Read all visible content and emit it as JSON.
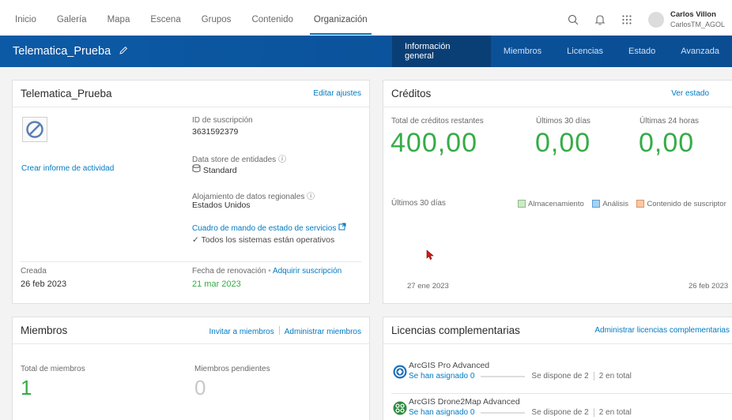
{
  "nav": {
    "links": [
      "Inicio",
      "Galería",
      "Mapa",
      "Escena",
      "Grupos",
      "Contenido",
      "Organización"
    ],
    "user_name": "Carlos Villon",
    "user_id": "CarlosTM_AGOL"
  },
  "banner": {
    "title": "Telematica_Prueba",
    "tabs": [
      "Información general",
      "Miembros",
      "Licencias",
      "Estado",
      "Avanzada"
    ]
  },
  "org_card": {
    "title": "Telematica_Prueba",
    "edit_link": "Editar ajustes",
    "activity_link": "Crear informe de actividad",
    "subscription_id_label": "ID de suscripción",
    "subscription_id": "3631592379",
    "datastore_label": "Data store de entidades",
    "datastore_value": "Standard",
    "hosting_label": "Alojamiento de datos regionales",
    "hosting_value": "Estados Unidos",
    "dashboard_link": "Cuadro de mando de estado de servicios",
    "systems_status": "Todos los sistemas están operativos",
    "created_label": "Creada",
    "created_value": "26 feb 2023",
    "renewal_label": "Fecha de renovación",
    "acquire_link": "Adquirir suscripción",
    "renewal_value": "21 mar 2023"
  },
  "credits_card": {
    "title": "Créditos",
    "view_link": "Ver estado",
    "remaining_label": "Total de créditos restantes",
    "remaining_value": "400,00",
    "last30_label": "Últimos 30 días",
    "last30_value": "0,00",
    "last24_label": "Últimas 24 horas",
    "last24_value": "0,00",
    "chart_label": "Últimos 30 días",
    "legend": [
      "Almacenamiento",
      "Análisis",
      "Contenido de suscriptor"
    ],
    "legend_colors": [
      "#cfe8c9",
      "#a8d2f2",
      "#f9c9a8"
    ],
    "start_date": "27 ene 2023",
    "end_date": "26 feb 2023"
  },
  "members_card": {
    "title": "Miembros",
    "invite_link": "Invitar a miembros",
    "manage_link": "Administrar miembros",
    "total_label": "Total de miembros",
    "total_value": "1",
    "pending_label": "Miembros pendientes",
    "pending_value": "0"
  },
  "addon_card": {
    "title": "Licencias complementarias",
    "manage_link": "Administrar licencias complementarias",
    "items": [
      {
        "name": "ArcGIS Pro Advanced",
        "assigned": "Se han asignado 0",
        "available": "Se dispone de 2",
        "total": "2 en total"
      },
      {
        "name": "ArcGIS Drone2Map Advanced",
        "assigned": "Se han asignado 0",
        "available": "Se dispone de 2",
        "total": "2 en total"
      }
    ]
  }
}
